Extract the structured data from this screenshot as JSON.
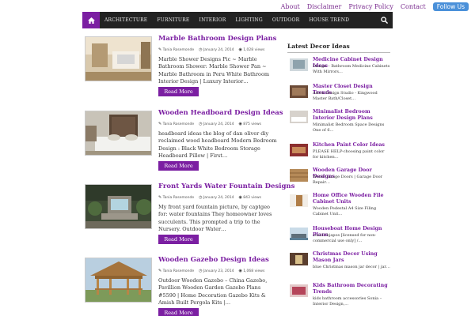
{
  "toplinks": {
    "about": "About",
    "disclaimer": "Disclaimer",
    "privacy": "Privacy Policy",
    "contact": "Contact",
    "follow": "Follow Us"
  },
  "nav": {
    "items": [
      "ARCHITECTURE",
      "FURNITURE",
      "INTERIOR",
      "LIGHTING",
      "OUTDOOR",
      "HOUSE TREND"
    ]
  },
  "posts": [
    {
      "title": "Marble Bathroom Design Plans",
      "author": "Tania Rosemonde",
      "date": "January 24, 2014",
      "views": "1,028 views",
      "excerpt": "Marble Shower Designs Pic ~ Marble Bathroom Shower: Marble Shower Pan ~ Marble Bathroom in Peru White Bathroom Interior Design | Luxury Interior…",
      "readmore": "Read More"
    },
    {
      "title": "Wooden Headboard Design Ideas",
      "author": "Tania Rosemonde",
      "date": "January 24, 2014",
      "views": "875 views",
      "excerpt": "headboard ideas the blog of dan oliver diy reclaimed wood headboard Modern Bedroom Design : Black White Bedroom Storage Headboard Pillow | First…",
      "readmore": "Read More"
    },
    {
      "title": "Front Yards Water Fountain Designs",
      "author": "Tania Rosemonde",
      "date": "January 24, 2014",
      "views": "843 views",
      "excerpt": "My front yard fountain picture, by captgeo for: water fountains They homeowner loves succulents. This prompted a trip to the Nursery. Outdoor Water…",
      "readmore": "Read More"
    },
    {
      "title": "Wooden Gazebo Design Ideas",
      "author": "Tania Rosemonde",
      "date": "January 23, 2014",
      "views": "1,068 views",
      "excerpt": "Outdoor Wooden Gazebo – China Gazebo, Pavillion Wooden Garden Gazebo Plans #5590 | Home Decoration Gazebo Kits & Amish Built Pergola Kits |…",
      "readmore": "Read More"
    }
  ],
  "sidebar": {
    "title": "Latest Decor Ideas",
    "items": [
      {
        "title": "Medicine Cabinet Design Ideas",
        "desc": "Design – Bathroom Medicine Cabinets With Mirrors…"
      },
      {
        "title": "Master Closet Design Trends",
        "desc": "Aston Design Studio - Kingwood Master Bath/Closet…"
      },
      {
        "title": "Minimalist Bedroom Interior Design Plans",
        "desc": "Minimalist Bedroom Space Designs One of 6…"
      },
      {
        "title": "Kitchen Paint Color Ideas",
        "desc": "PLEASE HELP-choosing paint color for kitchen…"
      },
      {
        "title": "Wooden Garage Door Designs",
        "desc": "Wood Garage Doors | Garage Door Repair…"
      },
      {
        "title": "Home Office Wooden File Cabinet Units",
        "desc": "Wooden Pedestal A4 Size Filing Cabinet Unit…"
      },
      {
        "title": "Houseboat Home Design Plans",
        "desc": "ccaz11bjapos [licensed for non-commercial use only] /…"
      },
      {
        "title": "Christmas Decor Using Mason Jars",
        "desc": "blue Christmas mason jar decor | jar…"
      },
      {
        "title": "Kids Bathroom Decorating Trends",
        "desc": "kids bathroom accessories Sonia – Interior Design,…"
      }
    ]
  },
  "colors": {
    "accent": "#7b1fa2",
    "nav_bg": "#222222",
    "follow_bg": "#4a90d9"
  },
  "icons": {
    "home": "home-icon",
    "search": "search-icon",
    "author": "pencil-icon",
    "date": "clock-icon",
    "views": "eye-icon"
  }
}
